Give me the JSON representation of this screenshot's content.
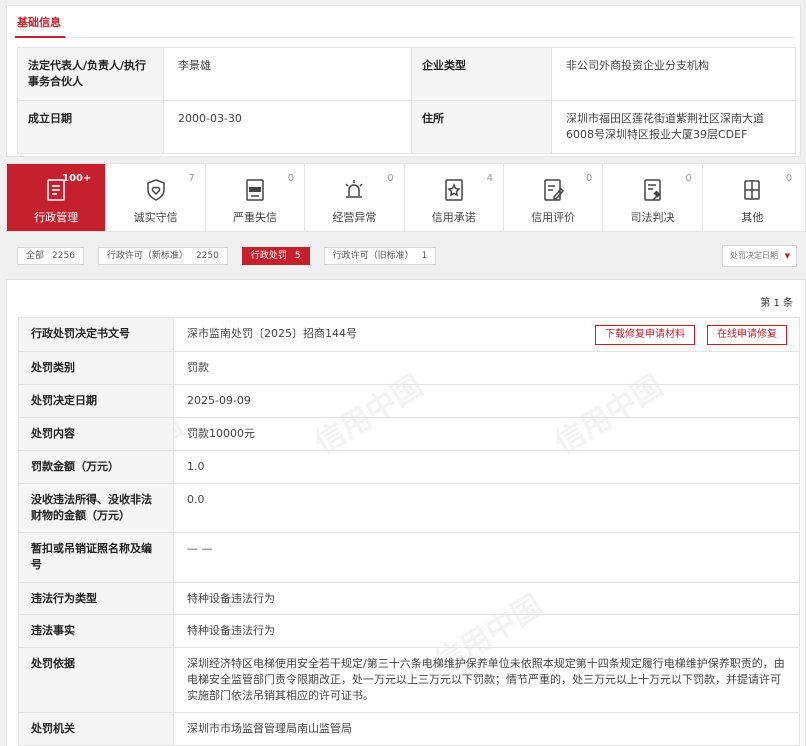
{
  "basic_info": {
    "title": "基础信息",
    "rows": [
      {
        "k1": "法定代表人/负责人/执行事务合伙人",
        "v1": "李景雄",
        "k2": "企业类型",
        "v2": "非公司外商投资企业分支机构"
      },
      {
        "k1": "成立日期",
        "v1": "2000-03-30",
        "k2": "住所",
        "v2": "深圳市福田区莲花街道紫荆社区深南大道6008号深圳特区报业大厦39层CDEF"
      }
    ]
  },
  "category_tabs": [
    {
      "label": "行政管理",
      "count": "100+",
      "icon": "admin-doc-icon",
      "active": true
    },
    {
      "label": "诚实守信",
      "count": "7",
      "icon": "shield-heart-icon",
      "active": false
    },
    {
      "label": "严重失信",
      "count": "0",
      "icon": "blacklist-doc-icon",
      "active": false
    },
    {
      "label": "经营异常",
      "count": "0",
      "icon": "alarm-light-icon",
      "active": false
    },
    {
      "label": "信用承诺",
      "count": "4",
      "icon": "star-doc-icon",
      "active": false
    },
    {
      "label": "信用评价",
      "count": "0",
      "icon": "edit-doc-icon",
      "active": false
    },
    {
      "label": "司法判决",
      "count": "0",
      "icon": "gavel-doc-icon",
      "active": false
    },
    {
      "label": "其他",
      "count": "0",
      "icon": "other-doc-icon",
      "active": false
    }
  ],
  "sub_tabs": [
    {
      "label": "全部",
      "count": "2256",
      "active": false
    },
    {
      "label": "行政许可（新标准）",
      "count": "2250",
      "active": false
    },
    {
      "label": "行政处罚",
      "count": "5",
      "active": true
    },
    {
      "label": "行政许可（旧标准）",
      "count": "1",
      "active": false
    }
  ],
  "sort_select": {
    "value": "处罚决定日期"
  },
  "record_count": "第 1 条",
  "buttons": {
    "download": "下载修复申请材料",
    "online_repair": "在线申请修复"
  },
  "watermark": "信用中国",
  "penalty": [
    {
      "k": "行政处罚决定书文号",
      "v": "深市监南处罚〔2025〕招商144号"
    },
    {
      "k": "处罚类别",
      "v": "罚款"
    },
    {
      "k": "处罚决定日期",
      "v": "2025-09-09"
    },
    {
      "k": "处罚内容",
      "v": "罚款10000元"
    },
    {
      "k": "罚款金额（万元）",
      "v": "1.0"
    },
    {
      "k": "没收违法所得、没收非法财物的金额（万元）",
      "v": "0.0"
    },
    {
      "k": "暂扣或吊销证照名称及编号",
      "v": "— —"
    },
    {
      "k": "违法行为类型",
      "v": "特种设备违法行为"
    },
    {
      "k": "违法事实",
      "v": "特种设备违法行为"
    },
    {
      "k": "处罚依据",
      "v": "深圳经济特区电梯使用安全若干规定/第三十六条电梯维护保养单位未依照本规定第十四条规定履行电梯维护保养职责的，由电梯安全监管部门责令限期改正，处一万元以上三万元以下罚款；情节严重的，处三万元以上十万元以下罚款，并提请许可实施部门依法吊销其相应的许可证书。"
    },
    {
      "k": "处罚机关",
      "v": "深圳市市场监督管理局南山监管局"
    }
  ],
  "colors": {
    "accent": "#c4202d",
    "key_bg": "#f5f5f5",
    "border": "#e3e3e3"
  }
}
